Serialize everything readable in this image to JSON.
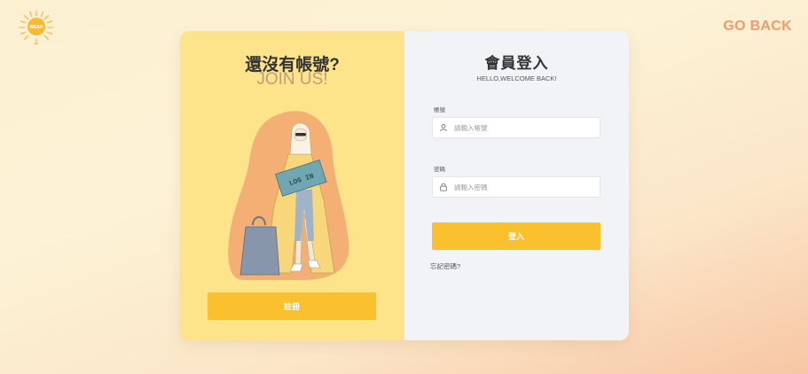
{
  "brand": {
    "logo_text": "WEAR",
    "logo_sub": "sun",
    "icon": "sun-logo-icon"
  },
  "nav": {
    "back_label": "GO BACK"
  },
  "signup_panel": {
    "title": "還沒有帳號?",
    "subtitle": "JOIN US!",
    "illustration_sign_text": "LOG IN",
    "register_label": "註冊"
  },
  "login_panel": {
    "title": "會員登入",
    "subtitle": "HELLO,WELCOME BACK!",
    "account": {
      "label": "帳號",
      "placeholder": "請輸入帳號",
      "value": "",
      "icon": "user-icon"
    },
    "password": {
      "label": "密碼",
      "placeholder": "請輸入密碼",
      "value": "",
      "icon": "lock-icon"
    },
    "login_label": "登入",
    "forgot_label": "忘記密碼?"
  },
  "colors": {
    "accent": "#fbc02d",
    "left_panel_bg": "#fde38a",
    "right_panel_bg": "#f1f3f6",
    "go_back": "#f09a72",
    "subtitle_muted": "#b9a17a"
  }
}
